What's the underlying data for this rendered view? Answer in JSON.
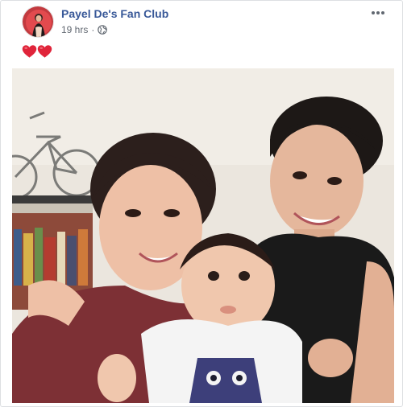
{
  "post": {
    "page_name": "Payel De's Fan Club",
    "timestamp": "19 hrs",
    "separator": "·",
    "privacy_icon": "globe-icon",
    "more_icon": "more-options-icon",
    "message_icons": [
      "red-heart-icon",
      "red-heart-icon"
    ]
  },
  "colors": {
    "link": "#385898",
    "meta": "#606770",
    "heart": "#e0243a"
  }
}
